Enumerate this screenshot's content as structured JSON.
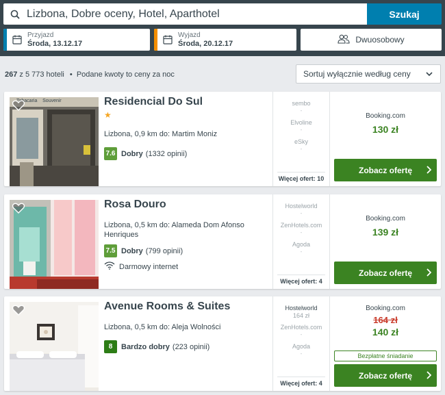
{
  "search": {
    "query": "Lizbona, Dobre oceny, Hotel, Aparthotel",
    "button": "Szukaj"
  },
  "checkin": {
    "label": "Przyjazd",
    "value": "Środa, 13.12.17",
    "accent": "#007faf"
  },
  "checkout": {
    "label": "Wyjazd",
    "value": "Środa, 20.12.17",
    "accent": "#f48f00"
  },
  "room": {
    "label": "Dwuosobowy"
  },
  "results": {
    "count_bold": "267",
    "count_rest": " z 5 773 hoteli",
    "note": "Podane kwoty to ceny za noc"
  },
  "sort": {
    "selected": "Sortuj wyłącznie według ceny"
  },
  "hotels": [
    {
      "name": "Residencial Do Sul",
      "stars": "★",
      "location": "Lizbona, 0,9 km do: Martim Moniz",
      "score": "7.6",
      "score_color": "#5f9e3a",
      "rating_label": "Dobry",
      "reviews": "(1332 opinii)",
      "offers": [
        {
          "site": "sembo",
          "price": ""
        },
        {
          "site": "Elvoline",
          "price": ""
        },
        {
          "site": "eSky",
          "price": ""
        }
      ],
      "more_offers": "Więcej ofert: 10",
      "provider": "Booking.com",
      "price": "130 zł",
      "cta": "Zobacz ofertę",
      "photo_text": "Tabacaria    Souvenir"
    },
    {
      "name": "Rosa Douro",
      "location": "Lizbona, 0,5 km do: Alameda Dom Afonso Henriques",
      "score": "7.5",
      "score_color": "#5f9e3a",
      "rating_label": "Dobry",
      "reviews": "(799 opinii)",
      "amenity": "Darmowy internet",
      "offers": [
        {
          "site": "Hostelworld",
          "price": ""
        },
        {
          "site": "ZenHotels.com",
          "price": ""
        },
        {
          "site": "Agoda",
          "price": ""
        }
      ],
      "more_offers": "Więcej ofert: 4",
      "provider": "Booking.com",
      "price": "139 zł",
      "cta": "Zobacz ofertę"
    },
    {
      "name": "Avenue Rooms & Suites",
      "location": "Lizbona, 0,5 km do: Aleja Wolności",
      "score": "8",
      "score_color": "#2d7d16",
      "rating_label": "Bardzo dobry",
      "reviews": "(223 opinii)",
      "offers": [
        {
          "site": "Hostelworld",
          "price": "164 zł"
        },
        {
          "site": "ZenHotels.com",
          "price": ""
        },
        {
          "site": "Agoda",
          "price": ""
        }
      ],
      "more_offers": "Więcej ofert: 4",
      "provider": "Booking.com",
      "old_price": "164 zł",
      "price": "140 zł",
      "badge": "Bezpłatne śniadanie",
      "cta": "Zobacz ofertę"
    }
  ]
}
